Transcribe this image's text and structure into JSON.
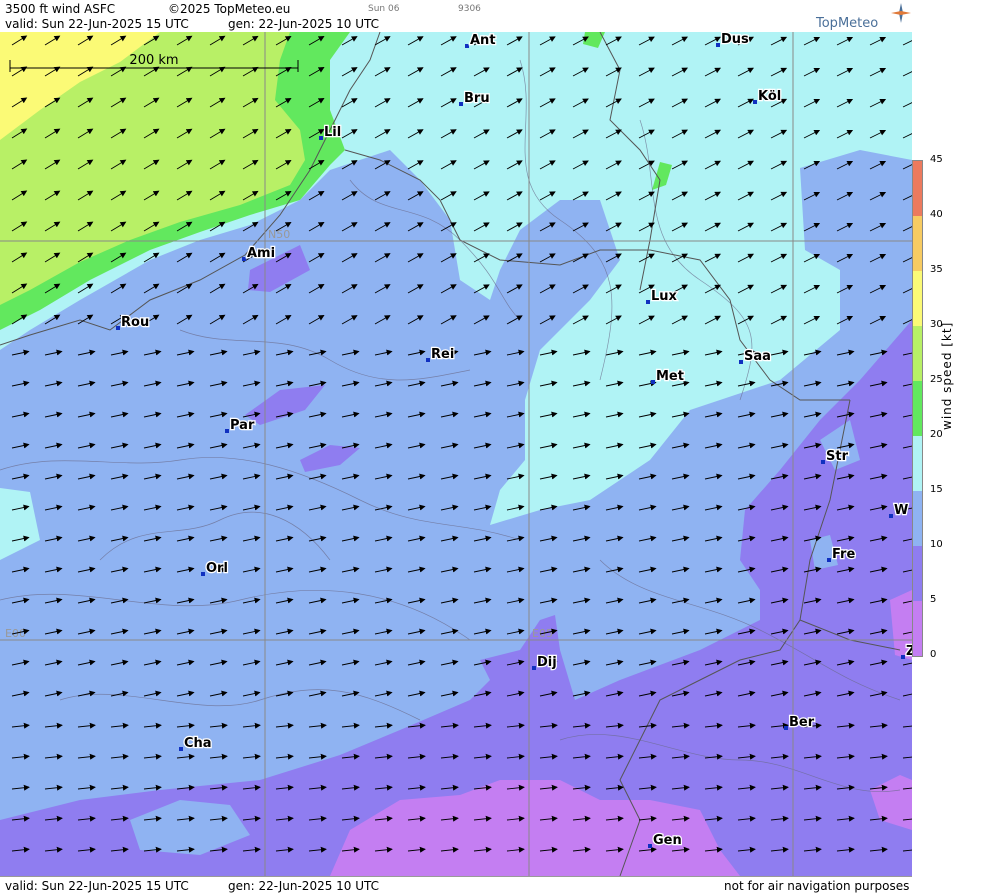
{
  "header": {
    "title": "3500 ft wind ASFC",
    "copyright": "©2025 TopMeteo.eu",
    "day_code": "Sun 06",
    "run_code": "9306",
    "valid_text": "valid:  Sun  22-Jun-2025  15 UTC",
    "gen_text": "gen: 22-Jun-2025 10 UTC",
    "brand": "TopMeteo"
  },
  "map": {
    "scale_label": "200 km",
    "grid_labels": {
      "lat": "N50",
      "lon0": "E00",
      "lon5": "E05"
    },
    "cities": [
      "Ant",
      "Dus",
      "Bru",
      "Köl",
      "Lil",
      "Ami",
      "Rou",
      "Rei",
      "Lux",
      "Saa",
      "Met",
      "Par",
      "Str",
      "W",
      "Fre",
      "Orl",
      "Dij",
      "Ber",
      "Cha",
      "Gen",
      "Z"
    ]
  },
  "footer": {
    "valid_text": "valid:  Sun  22-Jun-2025  15 UTC",
    "gen_text": "gen: 22-Jun-2025 10 UTC",
    "disclaimer": "not for air navigation purposes"
  },
  "legend": {
    "title": "wind speed [kt]",
    "ticks": [
      "45",
      "40",
      "35",
      "30",
      "25",
      "20",
      "15",
      "10",
      "5",
      "0"
    ],
    "colors": {
      "0-5": "#c47ef2",
      "5-10": "#8f7df0",
      "10-15": "#8fb3f2",
      "15-20": "#b0f3f5",
      "20-25": "#62e85e",
      "25-30": "#b8f066",
      "30-35": "#fbfa76",
      "35-40": "#f7cb62",
      "40-45": "#ec7a5e"
    }
  }
}
